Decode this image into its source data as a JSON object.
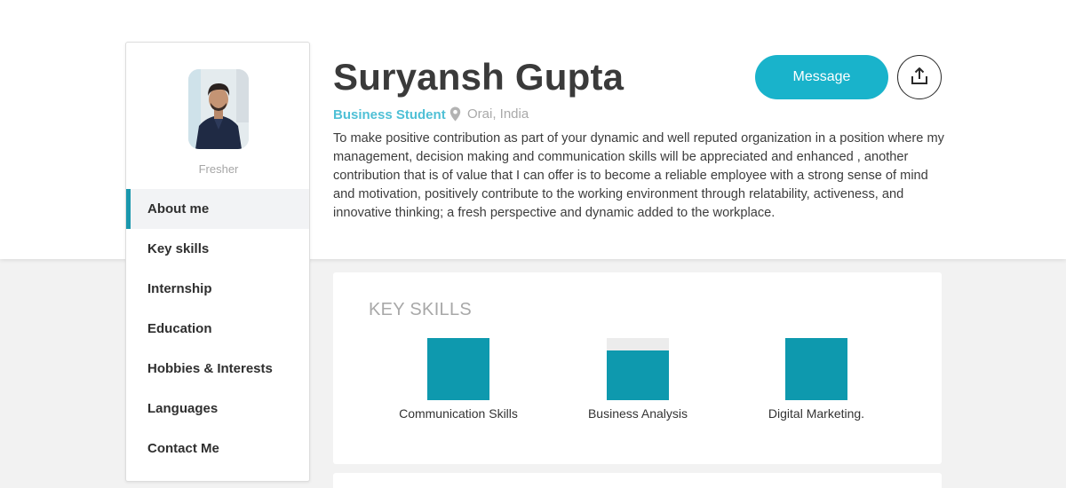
{
  "profile": {
    "name": "Suryansh Gupta",
    "role": "Business Student",
    "location": "Orai, India",
    "status": "Fresher",
    "about": "To make positive contribution as part of your dynamic and well reputed organization in a position where my management, decision making and communication skills will be appreciated and enhanced , another contribution that is of value that I can offer is to become a reliable employee with a strong sense of mind and motivation, positively contribute to the working environment through relatability, activeness, and innovative thinking; a fresh perspective and dynamic added to the workplace."
  },
  "actions": {
    "message_label": "Message",
    "share_icon": "share-upload-icon"
  },
  "nav": {
    "items": [
      {
        "label": "About me",
        "active": true
      },
      {
        "label": "Key skills"
      },
      {
        "label": "Internship"
      },
      {
        "label": "Education"
      },
      {
        "label": "Hobbies & Interests"
      },
      {
        "label": "Languages"
      },
      {
        "label": "Contact Me"
      }
    ]
  },
  "skills": {
    "title": "KEY SKILLS",
    "items": [
      {
        "label": "Communication Skills",
        "level": 1.0
      },
      {
        "label": "Business Analysis",
        "level": 0.8
      },
      {
        "label": "Digital Marketing.",
        "level": 1.0
      }
    ]
  },
  "colors": {
    "accent": "#19b3cb",
    "skill_fill": "#0e99ae",
    "role_text": "#4fc0d6",
    "nav_active_border": "#1a97ad"
  }
}
